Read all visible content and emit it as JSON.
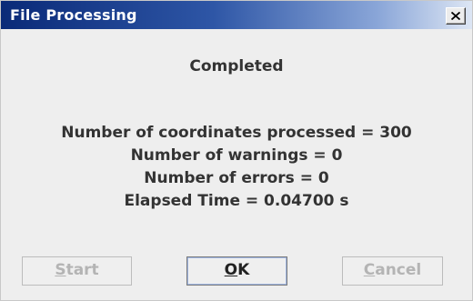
{
  "window": {
    "title": "File Processing"
  },
  "titlebar": {
    "close_icon": "close-x-icon",
    "gradient_colors": [
      "#0a2a78",
      "#2e56a6",
      "#8aa6d8",
      "#dde6f4"
    ]
  },
  "status": {
    "text": "Completed"
  },
  "stats": {
    "coordinates_processed": "Number of coordinates processed = 300",
    "warnings": "Number of warnings = 0",
    "errors": "Number of errors = 0",
    "elapsed_time": "Elapsed Time = 0.04700 s"
  },
  "buttons": {
    "start": {
      "mnemonic": "S",
      "rest": "tart",
      "enabled": false
    },
    "ok": {
      "mnemonic": "O",
      "rest": "K",
      "enabled": true
    },
    "cancel": {
      "mnemonic": "C",
      "rest": "ancel",
      "enabled": false
    }
  }
}
